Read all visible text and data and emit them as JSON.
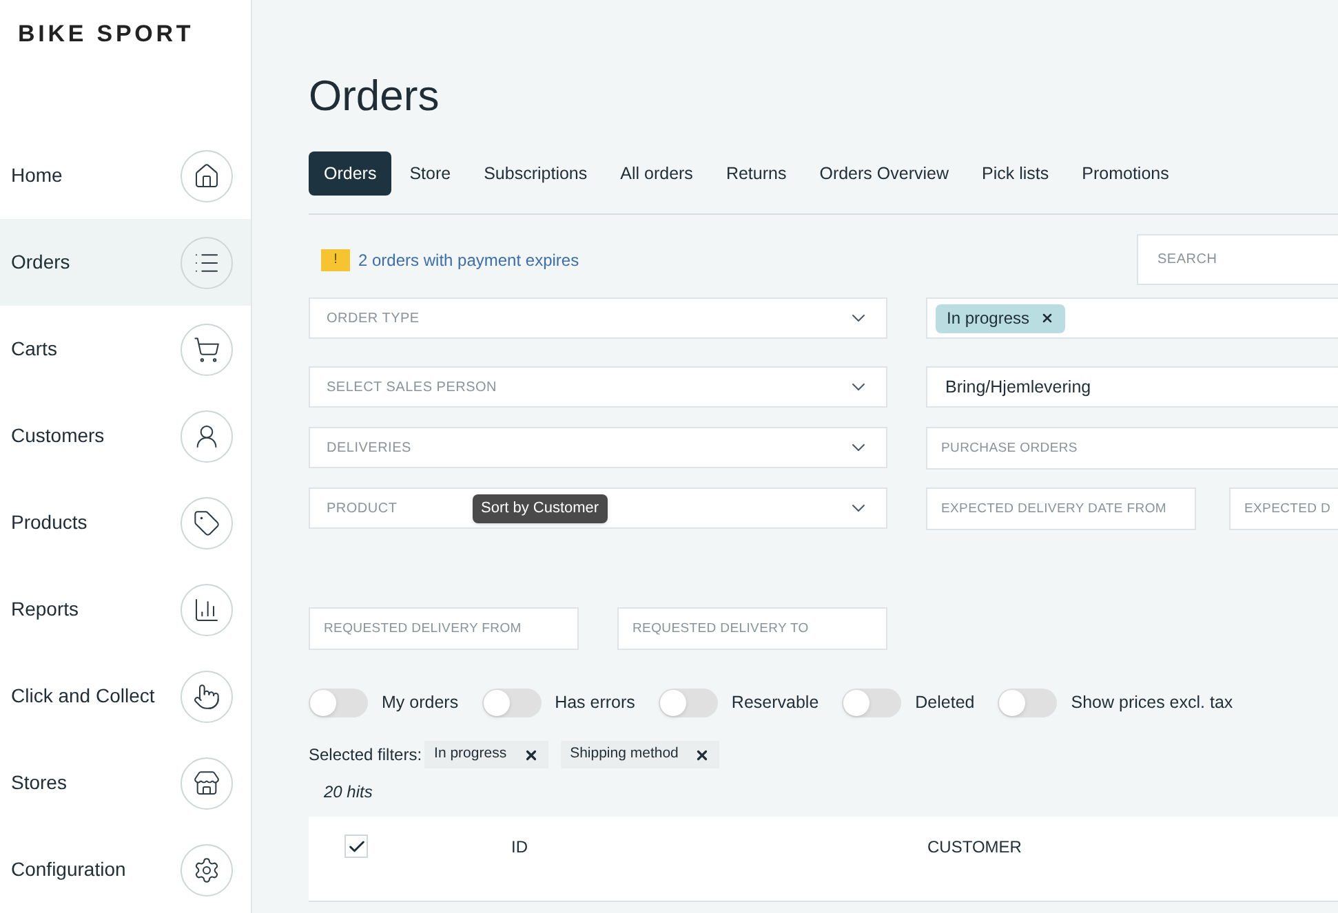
{
  "brand": "BIKE SPORT",
  "sidebar": {
    "items": [
      {
        "label": "Home",
        "selected": false
      },
      {
        "label": "Orders",
        "selected": true
      },
      {
        "label": "Carts",
        "selected": false
      },
      {
        "label": "Customers",
        "selected": false
      },
      {
        "label": "Products",
        "selected": false
      },
      {
        "label": "Reports",
        "selected": false
      },
      {
        "label": "Click and Collect",
        "selected": false
      },
      {
        "label": "Stores",
        "selected": false
      },
      {
        "label": "Configuration",
        "selected": false
      }
    ]
  },
  "page_title": "Orders",
  "tabs": [
    {
      "label": "Orders",
      "selected": true
    },
    {
      "label": "Store",
      "selected": false
    },
    {
      "label": "Subscriptions",
      "selected": false
    },
    {
      "label": "All orders",
      "selected": false
    },
    {
      "label": "Returns",
      "selected": false
    },
    {
      "label": "Orders Overview",
      "selected": false
    },
    {
      "label": "Pick lists",
      "selected": false
    },
    {
      "label": "Promotions",
      "selected": false
    }
  ],
  "notice": {
    "badge": "!",
    "text": "2 orders with payment expires"
  },
  "search": {
    "placeholder": "SEARCH"
  },
  "order_type": {
    "placeholder": "ORDER TYPE"
  },
  "status": {
    "tags": [
      "In progress"
    ]
  },
  "sales_person": {
    "placeholder": "SELECT SALES PERSON"
  },
  "shipping_method": {
    "value": "Bring/Hjemlevering"
  },
  "deliveries": {
    "placeholder": "DELIVERIES"
  },
  "purchase_orders": {
    "placeholder": "PURCHASE ORDERS"
  },
  "product": {
    "placeholder": "PRODUCT"
  },
  "tooltip": "Sort by Customer",
  "expected_delivery_from": {
    "placeholder": "EXPECTED DELIVERY DATE FROM"
  },
  "expected_delivery_to": {
    "placeholder": "EXPECTED D"
  },
  "requested_delivery_from": {
    "placeholder": "REQUESTED DELIVERY FROM"
  },
  "requested_delivery_to": {
    "placeholder": "REQUESTED DELIVERY TO"
  },
  "toggles": [
    {
      "label": "My orders",
      "on": false
    },
    {
      "label": "Has errors",
      "on": false
    },
    {
      "label": "Reservable",
      "on": false
    },
    {
      "label": "Deleted",
      "on": false
    },
    {
      "label": "Show prices excl. tax",
      "on": false
    }
  ],
  "selected_filters": {
    "label": "Selected filters:",
    "chips": [
      "In progress",
      "Shipping method"
    ]
  },
  "hits": "20 hits",
  "table": {
    "select_all_checked": true,
    "columns": [
      "ID",
      "CUSTOMER"
    ]
  }
}
